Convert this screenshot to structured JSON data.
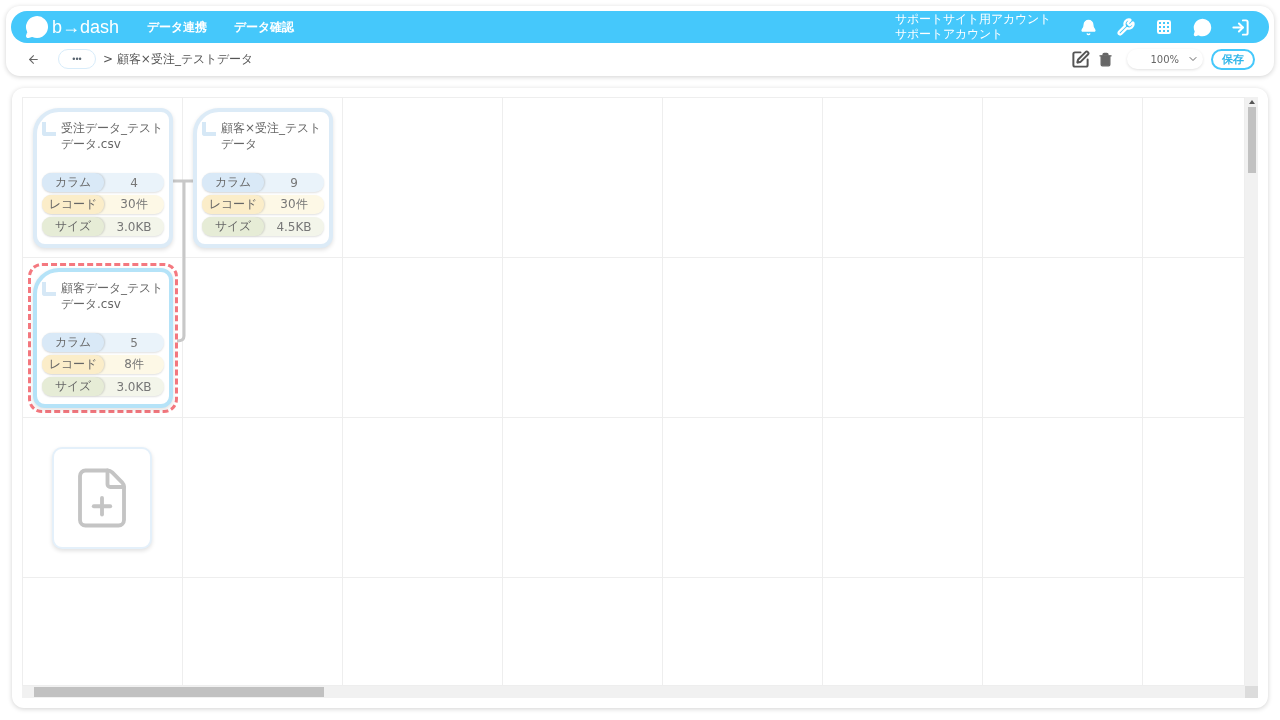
{
  "header": {
    "logo": "b→dash",
    "nav": [
      "データ連携",
      "データ確認"
    ],
    "account": [
      "サポートサイト用アカウント",
      "サポートアカウント"
    ]
  },
  "toolbar": {
    "more": "•••",
    "breadcrumb": "> 顧客×受注_テストデータ",
    "zoom": "100%",
    "save": "保存"
  },
  "nodes": [
    {
      "name": "受注データ_テストデータ.csv",
      "selected": false,
      "stats": [
        {
          "kind": "column",
          "label": "カラム",
          "value": "4"
        },
        {
          "kind": "record",
          "label": "レコード",
          "value": "30件"
        },
        {
          "kind": "size",
          "label": "サイズ",
          "value": "3.0KB"
        }
      ]
    },
    {
      "name": "顧客×受注_テストデータ",
      "selected": false,
      "stats": [
        {
          "kind": "column",
          "label": "カラム",
          "value": "9"
        },
        {
          "kind": "record",
          "label": "レコード",
          "value": "30件"
        },
        {
          "kind": "size",
          "label": "サイズ",
          "value": "4.5KB"
        }
      ]
    },
    {
      "name": "顧客データ_テストデータ.csv",
      "selected": true,
      "stats": [
        {
          "kind": "column",
          "label": "カラム",
          "value": "5"
        },
        {
          "kind": "record",
          "label": "レコード",
          "value": "8件"
        },
        {
          "kind": "size",
          "label": "サイズ",
          "value": "3.0KB"
        }
      ]
    }
  ]
}
